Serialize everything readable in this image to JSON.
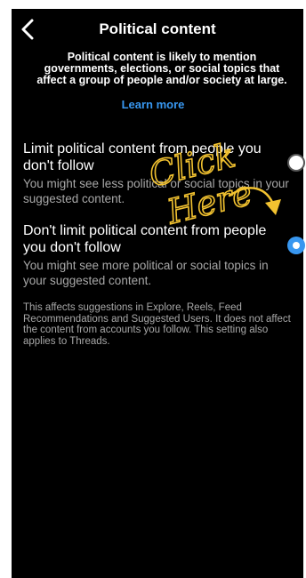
{
  "header": {
    "title": "Political content",
    "back_icon": "chevron-left-icon"
  },
  "intro": {
    "text": "Political content is likely to mention governments, elections, or social topics that affect a group of people and/or society at large.",
    "learn_more": "Learn more"
  },
  "options": [
    {
      "title": "Limit political content from people you don't follow",
      "description": "You might see less political or social topics in your suggested content.",
      "selected": false
    },
    {
      "title": "Don't limit political content from people you don't follow",
      "description": "You might see more political or social topics in your suggested content.",
      "selected": true
    }
  ],
  "note": "This affects suggestions in Explore, Reels, Feed Recommendations and Suggested Users. It does not affect the content from accounts you follow. This setting also applies to Threads.",
  "overlay": {
    "text": "Click Here",
    "color": "#f2c230"
  },
  "colors": {
    "accent": "#3897f0",
    "background": "#000000",
    "secondary_text": "#a8a8a8"
  }
}
